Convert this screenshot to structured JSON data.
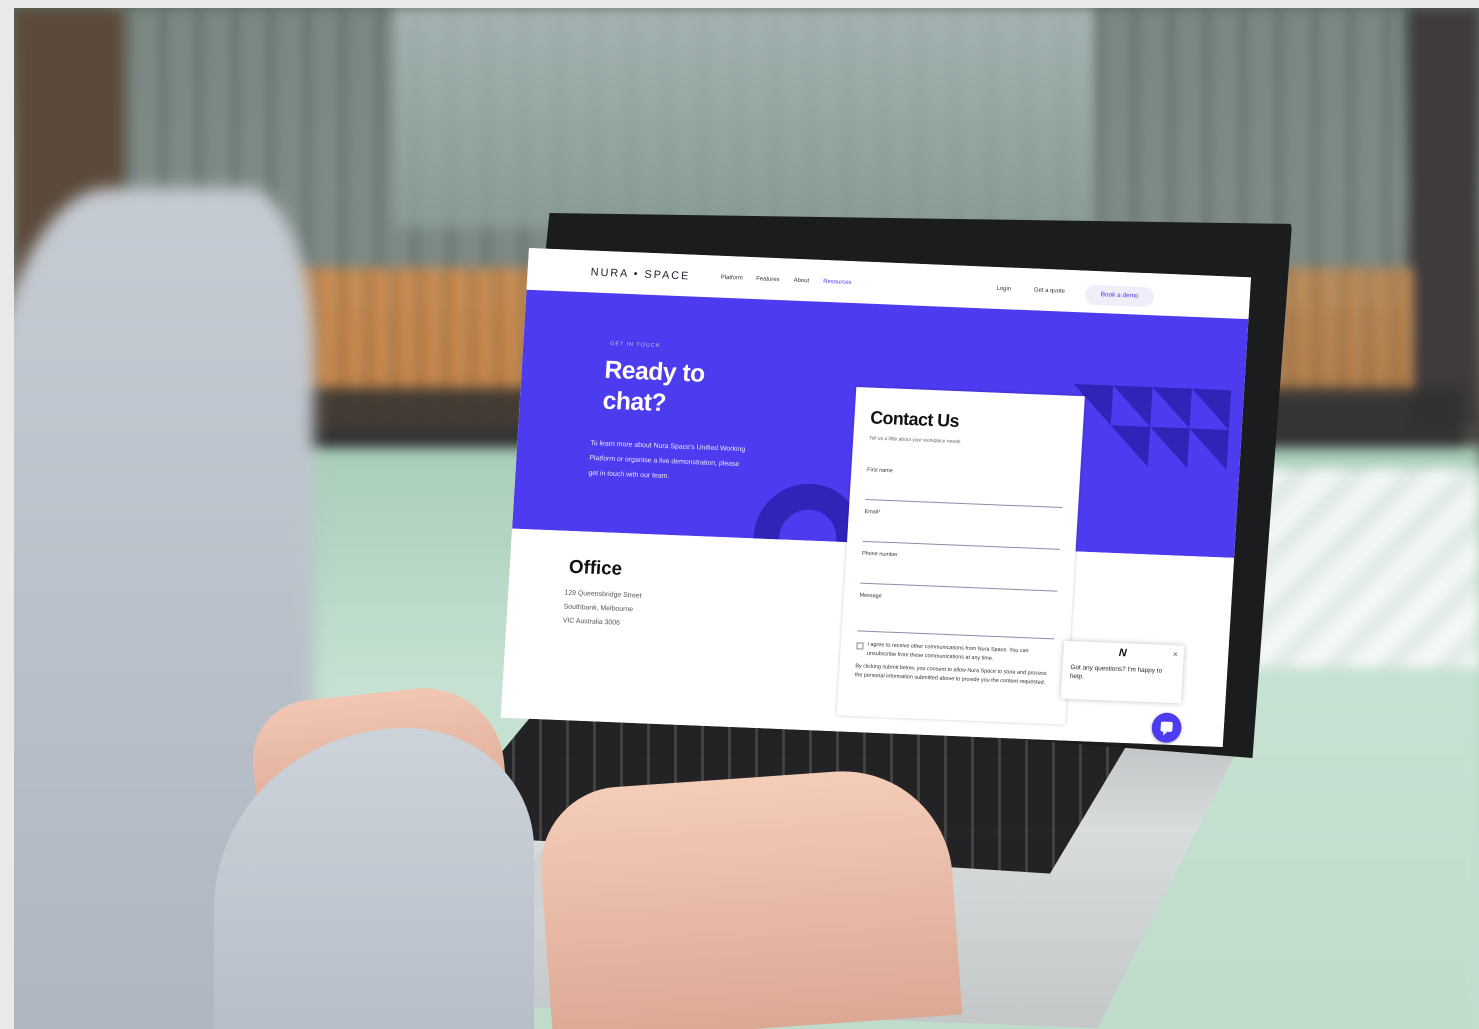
{
  "scene": {
    "description_free": true,
    "colors": {
      "accent": "#4d3bef",
      "laptop": "#c7cacc",
      "table": "#bcdcca"
    }
  },
  "website": {
    "logo": "NURA • SPACE",
    "nav": {
      "links": [
        "Platform",
        "Features",
        "About",
        "Resources"
      ],
      "login": "Login",
      "quote": "Get a quote",
      "demo": "Book a demo"
    },
    "hero": {
      "eyebrow": "GET IN TOUCH",
      "heading_line1": "Ready to",
      "heading_line2": "chat?",
      "text": "To learn more about Nura Space's Unified Working Platform or organise a live demonstration, please get in touch with our team."
    },
    "office": {
      "heading": "Office",
      "address_line1": "129 Queensbridge Street",
      "address_line2": "Southbank, Melbourne",
      "address_line3": "VIC Australia 3006"
    },
    "contact": {
      "heading": "Contact Us",
      "subheading": "Tell us a little about your workplace needs.",
      "fields": {
        "first_name": "First name",
        "email": "Email*",
        "phone": "Phone number",
        "message": "Message"
      },
      "consent_optin": "I agree to receive other communications from Nura Space. You can unsubscribe from these communications at any time.",
      "consent_processing": "By clicking submit below, you consent to allow Nura Space to store and process the personal information submitted above to provide you the content requested."
    },
    "chat": {
      "logo_letter": "N",
      "message": "Got any questions? I'm happy to help.",
      "close_symbol": "×"
    }
  }
}
